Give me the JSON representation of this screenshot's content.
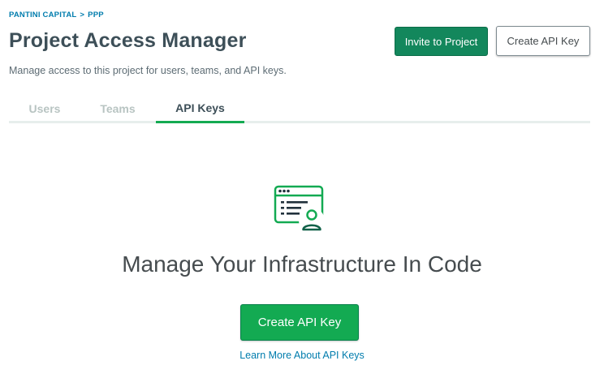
{
  "breadcrumb": {
    "org": "PANTINI CAPITAL",
    "separator": ">",
    "project": "PPP"
  },
  "header": {
    "title": "Project Access Manager",
    "subtitle": "Manage access to this project for users, teams, and API keys.",
    "invite_label": "Invite to Project",
    "create_key_label": "Create API Key"
  },
  "tabs": [
    {
      "label": "Users",
      "active": false
    },
    {
      "label": "Teams",
      "active": false
    },
    {
      "label": "API Keys",
      "active": true
    }
  ],
  "empty_state": {
    "icon": "api-code-user-icon",
    "heading": "Manage Your Infrastructure In Code",
    "cta_label": "Create API Key",
    "learn_more": "Learn More About API Keys"
  },
  "colors": {
    "primary_green": "#13aa52",
    "dark_green": "#13875c",
    "link_blue": "#007cad",
    "icon_dark": "#116149"
  }
}
